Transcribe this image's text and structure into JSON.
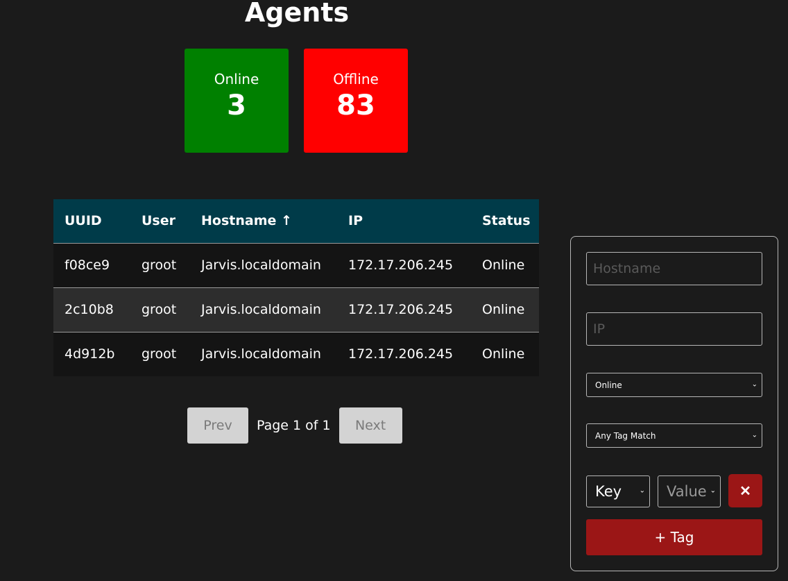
{
  "page": {
    "title": "Agents"
  },
  "stats": {
    "online": {
      "label": "Online",
      "value": "3",
      "color": "#008000"
    },
    "offline": {
      "label": "Offline",
      "value": "83",
      "color": "#ff0000"
    }
  },
  "table": {
    "header_color": "#003b49",
    "columns": [
      "UUID",
      "User",
      "Hostname ↑",
      "IP",
      "Status"
    ],
    "rows": [
      {
        "uuid": "f08ce9",
        "user": "groot",
        "hostname": "Jarvis.localdomain",
        "ip": "172.17.206.245",
        "status": "Online"
      },
      {
        "uuid": "2c10b8",
        "user": "groot",
        "hostname": "Jarvis.localdomain",
        "ip": "172.17.206.245",
        "status": "Online"
      },
      {
        "uuid": "4d912b",
        "user": "groot",
        "hostname": "Jarvis.localdomain",
        "ip": "172.17.206.245",
        "status": "Online"
      }
    ]
  },
  "pagination": {
    "prev_label": "Prev",
    "page_text": "Page 1 of 1",
    "next_label": "Next"
  },
  "filters": {
    "hostname_placeholder": "Hostname",
    "ip_placeholder": "IP",
    "status_selected": "Online",
    "tag_match_selected": "Any Tag Match",
    "key_selected": "Key",
    "value_selected": "Value",
    "remove_tag_icon": "close-icon",
    "add_tag_label": "+ Tag",
    "accent_color": "#9b1616"
  }
}
